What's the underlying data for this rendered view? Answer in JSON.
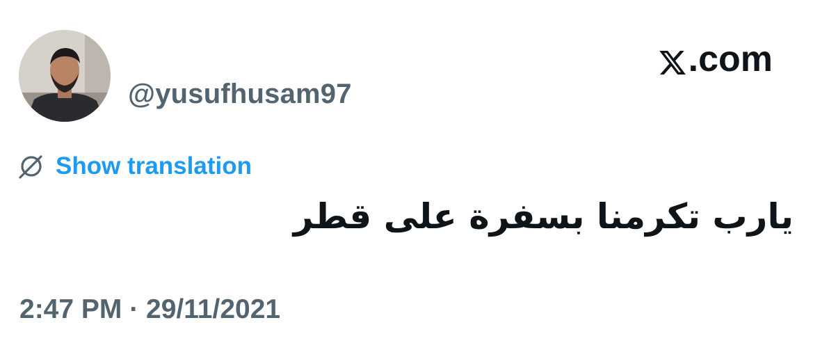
{
  "brand": {
    "icon": "x-logo-icon",
    "suffix": ".com"
  },
  "author": {
    "handle": "@yusufhusam97",
    "avatar": "avatar"
  },
  "translate": {
    "icon": "globe-slash-icon",
    "label": "Show translation",
    "color": "#1d9bf0"
  },
  "tweet": {
    "text": "يارب تكرمنا بسفرة على قطر"
  },
  "meta": {
    "timestamp": "2:47 PM · 29/11/2021"
  },
  "colors": {
    "text_primary": "#0f1419",
    "text_secondary": "#536471",
    "accent": "#1d9bf0"
  }
}
